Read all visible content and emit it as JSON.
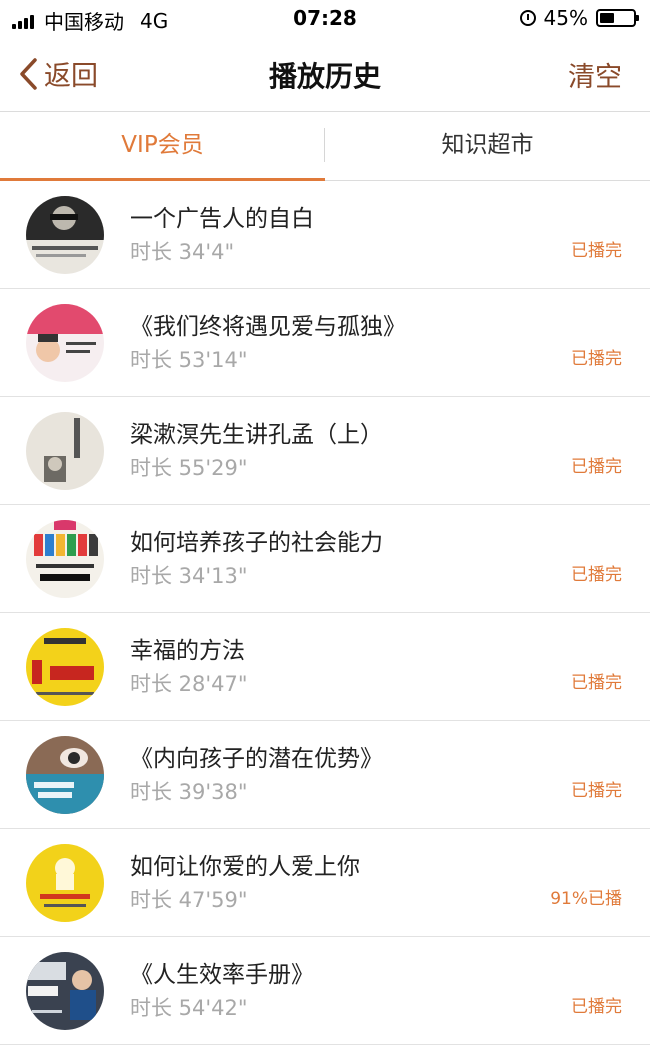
{
  "status_bar": {
    "carrier": "中国移动",
    "network": "4G",
    "time": "07:28",
    "battery": "45%"
  },
  "nav": {
    "back_label": "返回",
    "title": "播放历史",
    "clear_label": "清空"
  },
  "tabs": [
    {
      "label": "VIP会员",
      "active": true
    },
    {
      "label": "知识超市",
      "active": false
    }
  ],
  "colors": {
    "accent": "#e07a3a",
    "nav_text": "#8a4a2a"
  },
  "items": [
    {
      "title": "一个广告人的自白",
      "duration": "时长 34'4\"",
      "status": "已播完",
      "cover": "book-cover-1"
    },
    {
      "title": "《我们终将遇见爱与孤独》",
      "duration": "时长 53'14\"",
      "status": "已播完",
      "cover": "book-cover-2"
    },
    {
      "title": "梁漱溟先生讲孔孟（上）",
      "duration": "时长 55'29\"",
      "status": "已播完",
      "cover": "book-cover-3"
    },
    {
      "title": "如何培养孩子的社会能力",
      "duration": "时长 34'13\"",
      "status": "已播完",
      "cover": "book-cover-4"
    },
    {
      "title": "幸福的方法",
      "duration": "时长 28'47\"",
      "status": "已播完",
      "cover": "book-cover-5"
    },
    {
      "title": "《内向孩子的潜在优势》",
      "duration": "时长 39'38\"",
      "status": "已播完",
      "cover": "book-cover-6"
    },
    {
      "title": "如何让你爱的人爱上你",
      "duration": "时长 47'59\"",
      "status": "91%已播",
      "cover": "book-cover-7"
    },
    {
      "title": "《人生效率手册》",
      "duration": "时长 54'42\"",
      "status": "已播完",
      "cover": "book-cover-8"
    }
  ]
}
